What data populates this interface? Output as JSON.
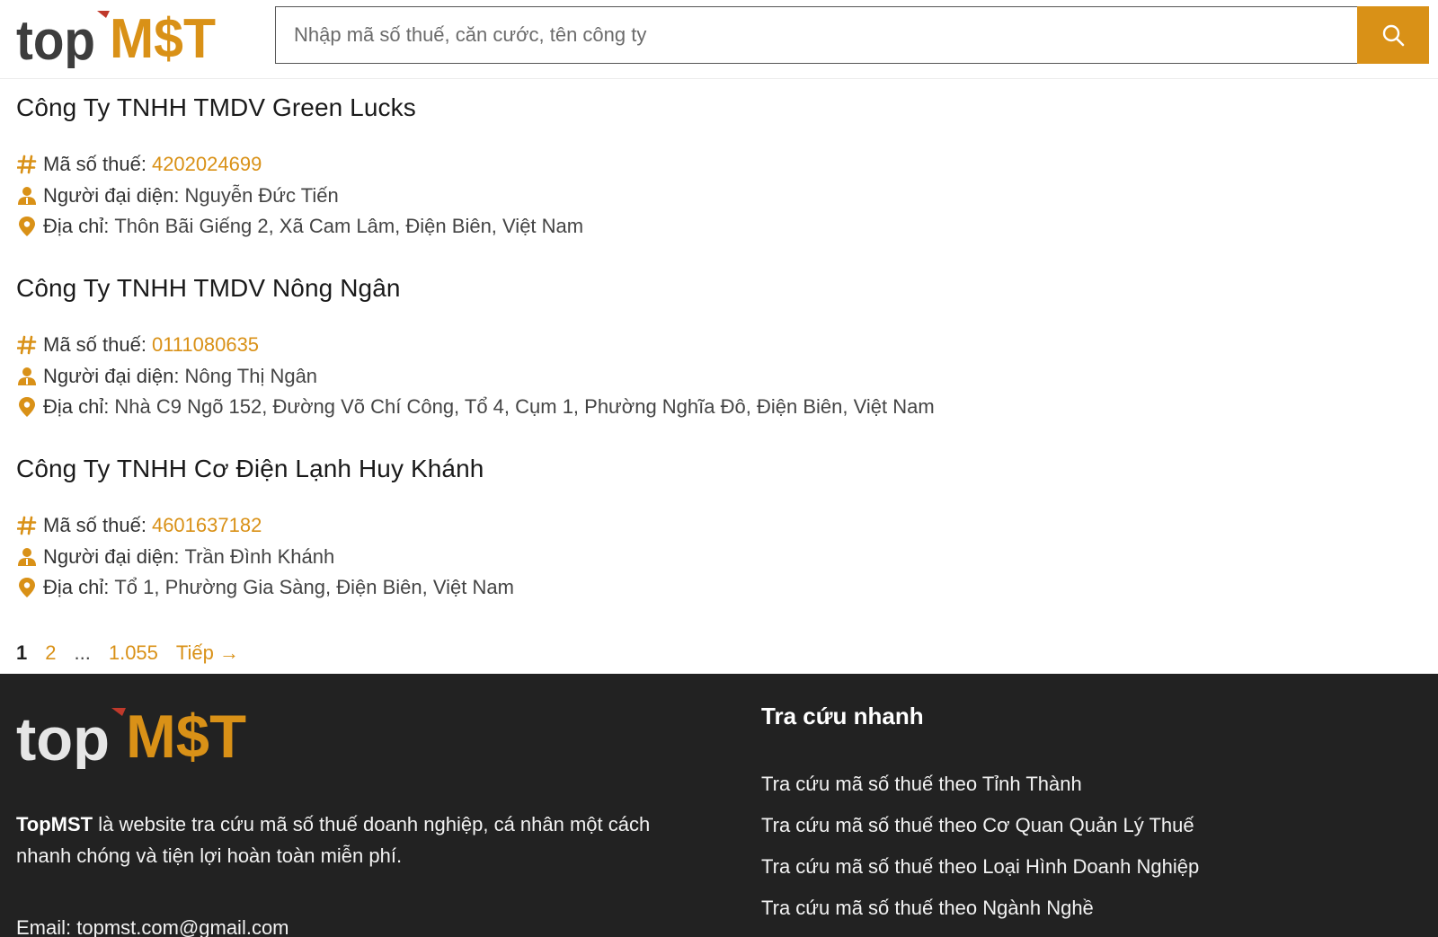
{
  "brand": {
    "logo_text_left": "top",
    "logo_text_right": "M$T",
    "accent_color": "#d99117",
    "dark_color": "#3a3a3a"
  },
  "search": {
    "placeholder": "Nhập mã số thuế, căn cước, tên công ty",
    "button_icon": "search-icon"
  },
  "labels": {
    "tax_code": "Mã số thuế:",
    "representative": "Người đại diện:",
    "address": "Địa chỉ:"
  },
  "companies": [
    {
      "name": "Công Ty TNHH TMDV Green Lucks",
      "tax_code": "4202024699",
      "representative": "Nguyễn Đức Tiến",
      "address": "Thôn Bãi Giếng 2, Xã Cam Lâm, Điện Biên, Việt Nam"
    },
    {
      "name": "Công Ty TNHH TMDV Nông Ngân",
      "tax_code": "0111080635",
      "representative": "Nông Thị Ngân",
      "address": "Nhà C9 Ngõ 152, Đường Võ Chí Công, Tổ 4, Cụm 1, Phường Nghĩa Đô, Điện Biên, Việt Nam"
    },
    {
      "name": "Công Ty TNHH Cơ Điện Lạnh Huy Khánh",
      "tax_code": "4601637182",
      "representative": "Trần Đình Khánh",
      "address": "Tổ 1, Phường Gia Sàng, Điện Biên, Việt Nam"
    }
  ],
  "pagination": {
    "current": "1",
    "next_page": "2",
    "ellipsis": "...",
    "last_page": "1.055",
    "next_label": "Tiếp →"
  },
  "footer": {
    "brand_name": "TopMST",
    "description": " là website tra cứu mã số thuế doanh nghiệp, cá nhân một cách nhanh chóng và tiện lợi hoàn toàn miễn phí.",
    "email": "Email: topmst.com@gmail.com",
    "quick_lookup_title": "Tra cứu nhanh",
    "links": [
      "Tra cứu mã số thuế theo Tỉnh Thành",
      "Tra cứu mã số thuế theo Cơ Quan Quản Lý Thuế",
      "Tra cứu mã số thuế theo Loại Hình Doanh Nghiệp",
      "Tra cứu mã số thuế theo Ngành Nghề"
    ]
  }
}
